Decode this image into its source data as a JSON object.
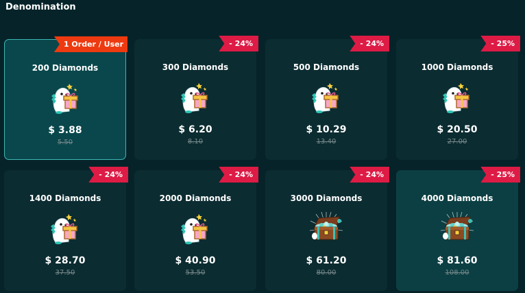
{
  "section_title": "Denomination",
  "cards": [
    {
      "name": "200 Diamonds",
      "price": "$ 3.88",
      "original": "5.50",
      "badge": "1 Order / User",
      "icon": "dino-gift-icon"
    },
    {
      "name": "300 Diamonds",
      "price": "$ 6.20",
      "original": "8.10",
      "badge": "- 24%",
      "icon": "dino-gift-icon"
    },
    {
      "name": "500 Diamonds",
      "price": "$ 10.29",
      "original": "13.40",
      "badge": "- 24%",
      "icon": "dino-gift-icon"
    },
    {
      "name": "1000 Diamonds",
      "price": "$ 20.50",
      "original": "27.00",
      "badge": "- 25%",
      "icon": "dino-gift-icon"
    },
    {
      "name": "1400 Diamonds",
      "price": "$ 28.70",
      "original": "37.50",
      "badge": "- 24%",
      "icon": "dino-gift-icon"
    },
    {
      "name": "2000 Diamonds",
      "price": "$ 40.90",
      "original": "53.50",
      "badge": "- 24%",
      "icon": "dino-gift-icon"
    },
    {
      "name": "3000 Diamonds",
      "price": "$ 61.20",
      "original": "80.00",
      "badge": "- 24%",
      "icon": "treasure-chest-icon"
    },
    {
      "name": "4000 Diamonds",
      "price": "$ 81.60",
      "original": "108.00",
      "badge": "- 25%",
      "icon": "treasure-chest-icon"
    }
  ]
}
